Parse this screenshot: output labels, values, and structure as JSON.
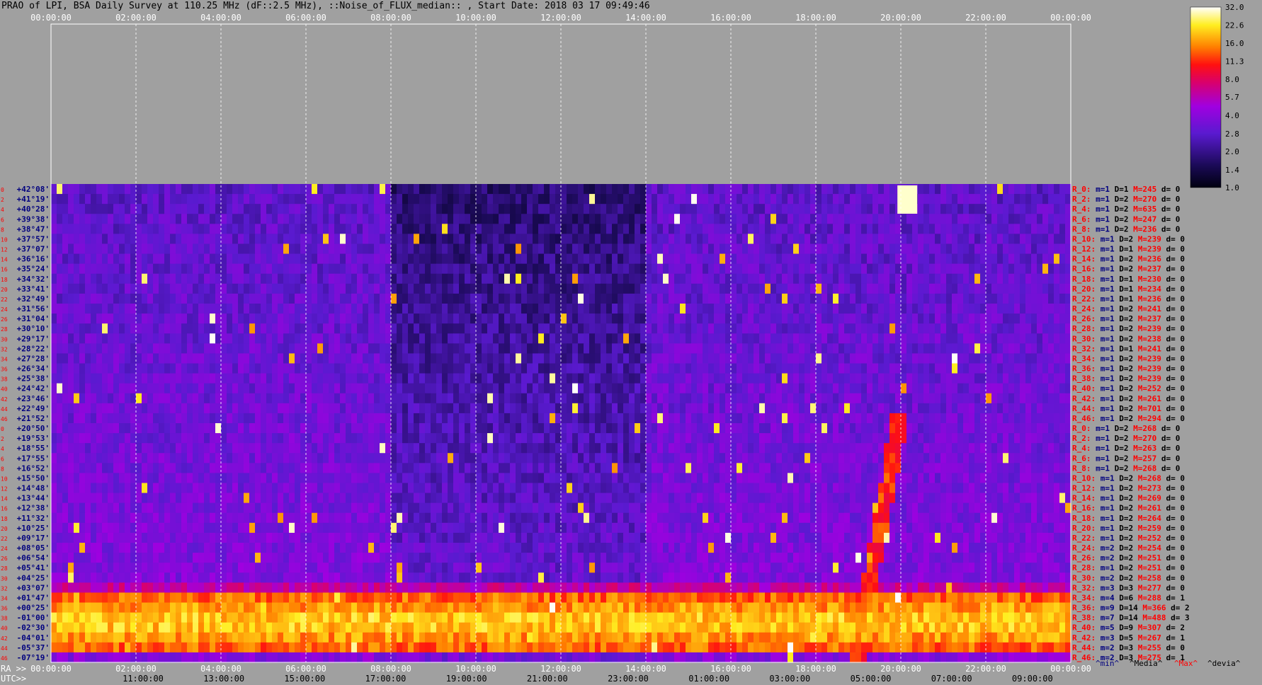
{
  "title": "PRAO of LPI, BSA Daily Survey at 110.25 MHz (dF::2.5 MHz), ::Noise_of_FLUX_median:: , Start Date: 2018 03 17 09:49:46",
  "chart_data": {
    "type": "heatmap",
    "x_top_ticks": [
      "00:00:00",
      "02:00:00",
      "04:00:00",
      "06:00:00",
      "08:00:00",
      "10:00:00",
      "12:00:00",
      "14:00:00",
      "16:00:00",
      "18:00:00",
      "20:00:00",
      "22:00:00",
      "00:00:00"
    ],
    "x_bottom_ra_label": "RA >>",
    "x_bottom_ra_ticks": [
      "00:00:00",
      "02:00:00",
      "04:00:00",
      "06:00:00",
      "08:00:00",
      "10:00:00",
      "12:00:00",
      "14:00:00",
      "16:00:00",
      "18:00:00",
      "20:00:00",
      "22:00:00",
      "00:00:00"
    ],
    "x_bottom_utc_label": "UTC>>",
    "x_bottom_utc_ticks": [
      "11:00:00",
      "13:00:00",
      "15:00:00",
      "17:00:00",
      "19:00:00",
      "21:00:00",
      "23:00:00",
      "01:00:00",
      "03:00:00",
      "05:00:00",
      "07:00:00",
      "09:00:00"
    ],
    "y_declinations": [
      "+42°08'",
      "+41°19'",
      "+40°28'",
      "+39°38'",
      "+38°47'",
      "+37°57'",
      "+37°07'",
      "+36°16'",
      "+35°24'",
      "+34°32'",
      "+33°41'",
      "+32°49'",
      "+31°56'",
      "+31°04'",
      "+30°10'",
      "+29°17'",
      "+28°22'",
      "+27°28'",
      "+26°34'",
      "+25°38'",
      "+24°42'",
      "+23°46'",
      "+22°49'",
      "+21°52'",
      "+20°50'",
      "+19°53'",
      "+18°55'",
      "+17°55'",
      "+16°52'",
      "+15°50'",
      "+14°48'",
      "+13°44'",
      "+12°38'",
      "+11°32'",
      "+10°25'",
      "+09°17'",
      "+08°05'",
      "+06°54'",
      "+05°41'",
      "+04°25'",
      "+03°07'",
      "+01°47'",
      "+00°25'",
      "-01°00'",
      "-02°30'",
      "-04°01'",
      "-05°37'",
      "-07°19'"
    ],
    "y_beam_numbers": [
      "0",
      "2",
      "4",
      "6",
      "8",
      "10",
      "12",
      "14",
      "16",
      "18",
      "20",
      "22",
      "24",
      "26",
      "28",
      "30",
      "32",
      "34",
      "36",
      "38",
      "40",
      "42",
      "44",
      "46",
      "0",
      "2",
      "4",
      "6",
      "8",
      "10",
      "12",
      "14",
      "16",
      "18",
      "20",
      "22",
      "24",
      "26",
      "28",
      "30",
      "32",
      "34",
      "36",
      "38",
      "40",
      "42",
      "44",
      "46"
    ],
    "right_stats": [
      {
        "r": "R_0:",
        "m": "m=1",
        "d": "D=1",
        "max": "M=245",
        "dev": "d= 0"
      },
      {
        "r": "R_2:",
        "m": "m=1",
        "d": "D=2",
        "max": "M=270",
        "dev": "d= 0"
      },
      {
        "r": "R_4:",
        "m": "m=1",
        "d": "D=2",
        "max": "M=635",
        "dev": "d= 0"
      },
      {
        "r": "R_6:",
        "m": "m=1",
        "d": "D=2",
        "max": "M=247",
        "dev": "d= 0"
      },
      {
        "r": "R_8:",
        "m": "m=1",
        "d": "D=2",
        "max": "M=236",
        "dev": "d= 0"
      },
      {
        "r": "R_10:",
        "m": "m=1",
        "d": "D=2",
        "max": "M=239",
        "dev": "d= 0"
      },
      {
        "r": "R_12:",
        "m": "m=1",
        "d": "D=1",
        "max": "M=239",
        "dev": "d= 0"
      },
      {
        "r": "R_14:",
        "m": "m=1",
        "d": "D=2",
        "max": "M=236",
        "dev": "d= 0"
      },
      {
        "r": "R_16:",
        "m": "m=1",
        "d": "D=2",
        "max": "M=237",
        "dev": "d= 0"
      },
      {
        "r": "R_18:",
        "m": "m=1",
        "d": "D=1",
        "max": "M=230",
        "dev": "d= 0"
      },
      {
        "r": "R_20:",
        "m": "m=1",
        "d": "D=1",
        "max": "M=234",
        "dev": "d= 0"
      },
      {
        "r": "R_22:",
        "m": "m=1",
        "d": "D=1",
        "max": "M=236",
        "dev": "d= 0"
      },
      {
        "r": "R_24:",
        "m": "m=1",
        "d": "D=2",
        "max": "M=241",
        "dev": "d= 0"
      },
      {
        "r": "R_26:",
        "m": "m=1",
        "d": "D=2",
        "max": "M=237",
        "dev": "d= 0"
      },
      {
        "r": "R_28:",
        "m": "m=1",
        "d": "D=2",
        "max": "M=239",
        "dev": "d= 0"
      },
      {
        "r": "R_30:",
        "m": "m=1",
        "d": "D=2",
        "max": "M=238",
        "dev": "d= 0"
      },
      {
        "r": "R_32:",
        "m": "m=1",
        "d": "D=1",
        "max": "M=241",
        "dev": "d= 0"
      },
      {
        "r": "R_34:",
        "m": "m=1",
        "d": "D=2",
        "max": "M=239",
        "dev": "d= 0"
      },
      {
        "r": "R_36:",
        "m": "m=1",
        "d": "D=2",
        "max": "M=239",
        "dev": "d= 0"
      },
      {
        "r": "R_38:",
        "m": "m=1",
        "d": "D=2",
        "max": "M=239",
        "dev": "d= 0"
      },
      {
        "r": "R_40:",
        "m": "m=1",
        "d": "D=2",
        "max": "M=252",
        "dev": "d= 0"
      },
      {
        "r": "R_42:",
        "m": "m=1",
        "d": "D=2",
        "max": "M=261",
        "dev": "d= 0"
      },
      {
        "r": "R_44:",
        "m": "m=1",
        "d": "D=2",
        "max": "M=701",
        "dev": "d= 0"
      },
      {
        "r": "R_46:",
        "m": "m=1",
        "d": "D=2",
        "max": "M=294",
        "dev": "d= 0"
      },
      {
        "r": "R_0:",
        "m": "m=1",
        "d": "D=2",
        "max": "M=268",
        "dev": "d= 0"
      },
      {
        "r": "R_2:",
        "m": "m=1",
        "d": "D=2",
        "max": "M=270",
        "dev": "d= 0"
      },
      {
        "r": "R_4:",
        "m": "m=1",
        "d": "D=2",
        "max": "M=263",
        "dev": "d= 0"
      },
      {
        "r": "R_6:",
        "m": "m=1",
        "d": "D=2",
        "max": "M=257",
        "dev": "d= 0"
      },
      {
        "r": "R_8:",
        "m": "m=1",
        "d": "D=2",
        "max": "M=268",
        "dev": "d= 0"
      },
      {
        "r": "R_10:",
        "m": "m=1",
        "d": "D=2",
        "max": "M=268",
        "dev": "d= 0"
      },
      {
        "r": "R_12:",
        "m": "m=1",
        "d": "D=2",
        "max": "M=273",
        "dev": "d= 0"
      },
      {
        "r": "R_14:",
        "m": "m=1",
        "d": "D=2",
        "max": "M=269",
        "dev": "d= 0"
      },
      {
        "r": "R_16:",
        "m": "m=1",
        "d": "D=2",
        "max": "M=261",
        "dev": "d= 0"
      },
      {
        "r": "R_18:",
        "m": "m=1",
        "d": "D=2",
        "max": "M=264",
        "dev": "d= 0"
      },
      {
        "r": "R_20:",
        "m": "m=1",
        "d": "D=2",
        "max": "M=259",
        "dev": "d= 0"
      },
      {
        "r": "R_22:",
        "m": "m=1",
        "d": "D=2",
        "max": "M=252",
        "dev": "d= 0"
      },
      {
        "r": "R_24:",
        "m": "m=2",
        "d": "D=2",
        "max": "M=254",
        "dev": "d= 0"
      },
      {
        "r": "R_26:",
        "m": "m=2",
        "d": "D=2",
        "max": "M=251",
        "dev": "d= 0"
      },
      {
        "r": "R_28:",
        "m": "m=1",
        "d": "D=2",
        "max": "M=251",
        "dev": "d= 0"
      },
      {
        "r": "R_30:",
        "m": "m=2",
        "d": "D=2",
        "max": "M=258",
        "dev": "d= 0"
      },
      {
        "r": "R_32:",
        "m": "m=3",
        "d": "D=3",
        "max": "M=277",
        "dev": "d= 0"
      },
      {
        "r": "R_34:",
        "m": "m=4",
        "d": "D=6",
        "max": "M=288",
        "dev": "d= 1"
      },
      {
        "r": "R_36:",
        "m": "m=9",
        "d": "D=14",
        "max": "M=366",
        "dev": "d= 2"
      },
      {
        "r": "R_38:",
        "m": "m=7",
        "d": "D=14",
        "max": "M=488",
        "dev": "d= 3"
      },
      {
        "r": "R_40:",
        "m": "m=5",
        "d": "D=9",
        "max": "M=307",
        "dev": "d= 2"
      },
      {
        "r": "R_42:",
        "m": "m=3",
        "d": "D=5",
        "max": "M=267",
        "dev": "d= 1"
      },
      {
        "r": "R_44:",
        "m": "m=2",
        "d": "D=3",
        "max": "M=255",
        "dev": "d= 0"
      },
      {
        "r": "R_46:",
        "m": "m=2",
        "d": "D=3",
        "max": "M=275",
        "dev": "d= 1"
      }
    ],
    "stat_legend": [
      "^min^",
      "^Media^",
      "^Max^",
      "^devia^"
    ],
    "colorbar_ticks": [
      "32.0",
      "22.6",
      "16.0",
      "11.3",
      "8.0",
      "5.7",
      "4.0",
      "2.8",
      "2.0",
      "1.4",
      "1.0"
    ],
    "colorbar_range": [
      1.0,
      32.0
    ],
    "colorbar_scale": "log",
    "colors": {
      "background": "#a0a0a0",
      "label_red": "#ff0000",
      "label_blue": "#00007f",
      "grid": "#ffffff"
    }
  }
}
